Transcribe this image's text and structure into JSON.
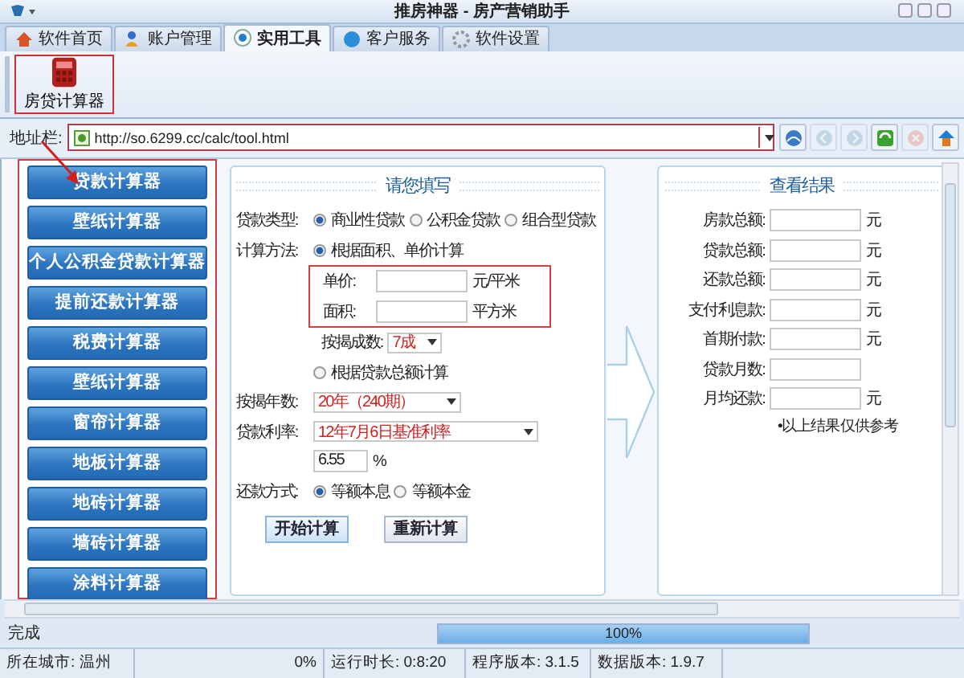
{
  "window": {
    "title": "推房神器 - 房产营销助手"
  },
  "tabs": [
    {
      "label": "软件首页",
      "selected": false
    },
    {
      "label": "账户管理",
      "selected": false
    },
    {
      "label": "实用工具",
      "selected": true
    },
    {
      "label": "客户服务",
      "selected": false
    },
    {
      "label": "软件设置",
      "selected": false
    }
  ],
  "toolbar": {
    "buttons": [
      {
        "label": "房贷计算器"
      }
    ]
  },
  "address_bar": {
    "label": "地址栏:",
    "value": "http://so.6299.cc/calc/tool.html",
    "nav_buttons": [
      {
        "disabled": false
      },
      {
        "disabled": true
      },
      {
        "disabled": true
      },
      {
        "disabled": false
      },
      {
        "disabled": true
      },
      {
        "disabled": false
      }
    ]
  },
  "sidebar": {
    "items": [
      {
        "label": "贷款计算器"
      },
      {
        "label": "壁纸计算器"
      },
      {
        "label": "个人公积金贷款计算器"
      },
      {
        "label": "提前还款计算器"
      },
      {
        "label": "税费计算器"
      },
      {
        "label": "壁纸计算器"
      },
      {
        "label": "窗帘计算器"
      },
      {
        "label": "地板计算器"
      },
      {
        "label": "地砖计算器"
      },
      {
        "label": "墙砖计算器"
      },
      {
        "label": "涂料计算器"
      }
    ]
  },
  "form": {
    "title": "请您填写",
    "loan_type": {
      "label": "贷款类型:",
      "options": [
        {
          "label": "商业性贷款",
          "selected": true
        },
        {
          "label": "公积金贷款",
          "selected": false
        },
        {
          "label": "组合型贷款",
          "selected": false
        }
      ]
    },
    "method": {
      "label": "计算方法:",
      "options": [
        {
          "label": "根据面积、单价计算",
          "selected": true
        },
        {
          "label": "根据贷款总额计算",
          "selected": false
        }
      ]
    },
    "fields": [
      {
        "label": "单价:",
        "unit": "元/平米"
      },
      {
        "label": "面积:",
        "unit": "平方米"
      }
    ],
    "ratio": {
      "label": "按揭成数:",
      "value": "7成"
    },
    "years": {
      "label": "按揭年数:",
      "value": "20年（240期）"
    },
    "rate": {
      "label": "贷款利率:",
      "value": "12年7月6日基准利率",
      "number": "6.55",
      "unit": "%"
    },
    "repay": {
      "label": "还款方式:",
      "options": [
        {
          "label": "等额本息",
          "selected": true
        },
        {
          "label": "等额本金",
          "selected": false
        }
      ]
    },
    "buttons": [
      "开始计算",
      "重新计算"
    ]
  },
  "results": {
    "title": "查看结果",
    "rows": [
      {
        "label": "房款总额:",
        "unit": "元"
      },
      {
        "label": "贷款总额:",
        "unit": "元"
      },
      {
        "label": "还款总额:",
        "unit": "元"
      },
      {
        "label": "支付利息款:",
        "unit": "元"
      },
      {
        "label": "首期付款:",
        "unit": "元"
      },
      {
        "label": "贷款月数:"
      },
      {
        "label": "月均还款:",
        "unit": "元"
      }
    ],
    "note": "•以上结果仅供参考"
  },
  "status_bar": {
    "text": "完成",
    "progress": {
      "level": 1,
      "reading": "100%"
    }
  },
  "info_bar": [
    {
      "text": "所在城市: 温州"
    },
    {
      "text": "0%"
    },
    {
      "text": "运行时长: 0:8:20"
    },
    {
      "text": "程序版本: 3.1.5"
    },
    {
      "text": "数据版本: 1.9.7"
    }
  ]
}
